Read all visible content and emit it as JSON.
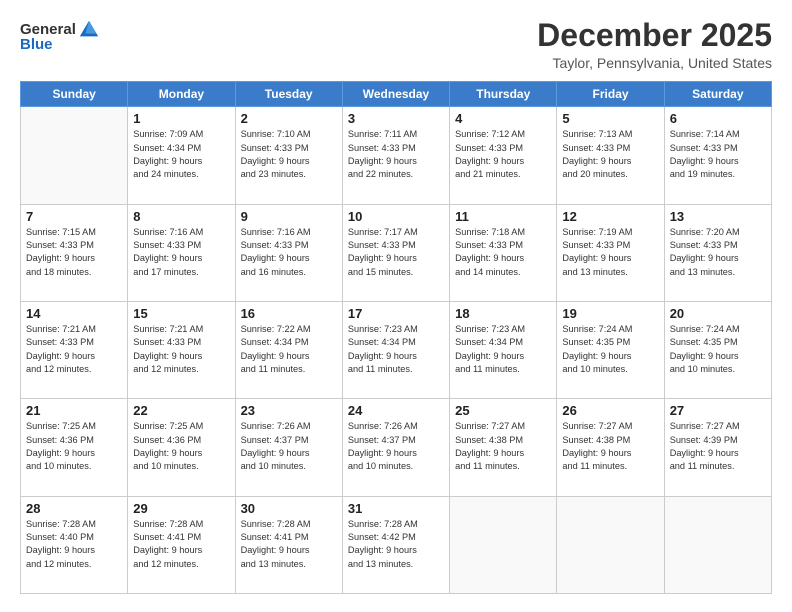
{
  "header": {
    "logo_general": "General",
    "logo_blue": "Blue",
    "title": "December 2025",
    "subtitle": "Taylor, Pennsylvania, United States"
  },
  "days_of_week": [
    "Sunday",
    "Monday",
    "Tuesday",
    "Wednesday",
    "Thursday",
    "Friday",
    "Saturday"
  ],
  "weeks": [
    [
      {
        "day": "",
        "info": ""
      },
      {
        "day": "1",
        "info": "Sunrise: 7:09 AM\nSunset: 4:34 PM\nDaylight: 9 hours\nand 24 minutes."
      },
      {
        "day": "2",
        "info": "Sunrise: 7:10 AM\nSunset: 4:33 PM\nDaylight: 9 hours\nand 23 minutes."
      },
      {
        "day": "3",
        "info": "Sunrise: 7:11 AM\nSunset: 4:33 PM\nDaylight: 9 hours\nand 22 minutes."
      },
      {
        "day": "4",
        "info": "Sunrise: 7:12 AM\nSunset: 4:33 PM\nDaylight: 9 hours\nand 21 minutes."
      },
      {
        "day": "5",
        "info": "Sunrise: 7:13 AM\nSunset: 4:33 PM\nDaylight: 9 hours\nand 20 minutes."
      },
      {
        "day": "6",
        "info": "Sunrise: 7:14 AM\nSunset: 4:33 PM\nDaylight: 9 hours\nand 19 minutes."
      }
    ],
    [
      {
        "day": "7",
        "info": "Sunrise: 7:15 AM\nSunset: 4:33 PM\nDaylight: 9 hours\nand 18 minutes."
      },
      {
        "day": "8",
        "info": "Sunrise: 7:16 AM\nSunset: 4:33 PM\nDaylight: 9 hours\nand 17 minutes."
      },
      {
        "day": "9",
        "info": "Sunrise: 7:16 AM\nSunset: 4:33 PM\nDaylight: 9 hours\nand 16 minutes."
      },
      {
        "day": "10",
        "info": "Sunrise: 7:17 AM\nSunset: 4:33 PM\nDaylight: 9 hours\nand 15 minutes."
      },
      {
        "day": "11",
        "info": "Sunrise: 7:18 AM\nSunset: 4:33 PM\nDaylight: 9 hours\nand 14 minutes."
      },
      {
        "day": "12",
        "info": "Sunrise: 7:19 AM\nSunset: 4:33 PM\nDaylight: 9 hours\nand 13 minutes."
      },
      {
        "day": "13",
        "info": "Sunrise: 7:20 AM\nSunset: 4:33 PM\nDaylight: 9 hours\nand 13 minutes."
      }
    ],
    [
      {
        "day": "14",
        "info": "Sunrise: 7:21 AM\nSunset: 4:33 PM\nDaylight: 9 hours\nand 12 minutes."
      },
      {
        "day": "15",
        "info": "Sunrise: 7:21 AM\nSunset: 4:33 PM\nDaylight: 9 hours\nand 12 minutes."
      },
      {
        "day": "16",
        "info": "Sunrise: 7:22 AM\nSunset: 4:34 PM\nDaylight: 9 hours\nand 11 minutes."
      },
      {
        "day": "17",
        "info": "Sunrise: 7:23 AM\nSunset: 4:34 PM\nDaylight: 9 hours\nand 11 minutes."
      },
      {
        "day": "18",
        "info": "Sunrise: 7:23 AM\nSunset: 4:34 PM\nDaylight: 9 hours\nand 11 minutes."
      },
      {
        "day": "19",
        "info": "Sunrise: 7:24 AM\nSunset: 4:35 PM\nDaylight: 9 hours\nand 10 minutes."
      },
      {
        "day": "20",
        "info": "Sunrise: 7:24 AM\nSunset: 4:35 PM\nDaylight: 9 hours\nand 10 minutes."
      }
    ],
    [
      {
        "day": "21",
        "info": "Sunrise: 7:25 AM\nSunset: 4:36 PM\nDaylight: 9 hours\nand 10 minutes."
      },
      {
        "day": "22",
        "info": "Sunrise: 7:25 AM\nSunset: 4:36 PM\nDaylight: 9 hours\nand 10 minutes."
      },
      {
        "day": "23",
        "info": "Sunrise: 7:26 AM\nSunset: 4:37 PM\nDaylight: 9 hours\nand 10 minutes."
      },
      {
        "day": "24",
        "info": "Sunrise: 7:26 AM\nSunset: 4:37 PM\nDaylight: 9 hours\nand 10 minutes."
      },
      {
        "day": "25",
        "info": "Sunrise: 7:27 AM\nSunset: 4:38 PM\nDaylight: 9 hours\nand 11 minutes."
      },
      {
        "day": "26",
        "info": "Sunrise: 7:27 AM\nSunset: 4:38 PM\nDaylight: 9 hours\nand 11 minutes."
      },
      {
        "day": "27",
        "info": "Sunrise: 7:27 AM\nSunset: 4:39 PM\nDaylight: 9 hours\nand 11 minutes."
      }
    ],
    [
      {
        "day": "28",
        "info": "Sunrise: 7:28 AM\nSunset: 4:40 PM\nDaylight: 9 hours\nand 12 minutes."
      },
      {
        "day": "29",
        "info": "Sunrise: 7:28 AM\nSunset: 4:41 PM\nDaylight: 9 hours\nand 12 minutes."
      },
      {
        "day": "30",
        "info": "Sunrise: 7:28 AM\nSunset: 4:41 PM\nDaylight: 9 hours\nand 13 minutes."
      },
      {
        "day": "31",
        "info": "Sunrise: 7:28 AM\nSunset: 4:42 PM\nDaylight: 9 hours\nand 13 minutes."
      },
      {
        "day": "",
        "info": ""
      },
      {
        "day": "",
        "info": ""
      },
      {
        "day": "",
        "info": ""
      }
    ]
  ]
}
